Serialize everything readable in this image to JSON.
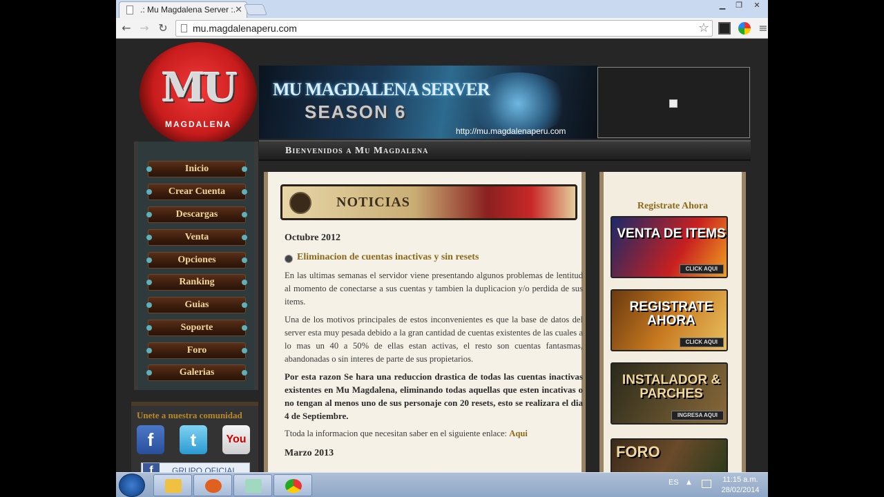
{
  "browser": {
    "tab_title": ".: Mu Magdalena Server :.",
    "url": "mu.magdalenaperu.com"
  },
  "header": {
    "logo_text": "MU",
    "logo_subtitle": "MAGDALENA",
    "banner_title": "MU MAGDALENA SERVER",
    "banner_season": "SEASON 6",
    "banner_url": "http://mu.magdalenaperu.com",
    "welcome": "Bienvenidos a Mu Magdalena"
  },
  "nav": {
    "items": [
      "Inicio",
      "Crear Cuenta",
      "Descargas",
      "Venta",
      "Opciones",
      "Ranking",
      "Guias",
      "Soporte",
      "Foro",
      "Galerias"
    ]
  },
  "community": {
    "title": "Unete a nuestra comunidad",
    "facebook": "f",
    "twitter": "t",
    "youtube": "You",
    "grupo": "GRUPO OFICIAL"
  },
  "news": {
    "section_title": "NOTICIAS",
    "month1": "Octubre 2012",
    "headline1": "Eliminacion de cuentas inactivas y sin resets",
    "p1": "En las ultimas semanas el servidor viene presentando algunos problemas de lentitud al momento de conectarse a sus cuentas y tambien la duplicacion y/o perdida de sus items.",
    "p2": "Una de los motivos principales de estos inconvenientes es que la base de datos del server esta muy pesada debido a la gran cantidad de cuentas existentes de las cuales a lo mas un 40 a 50% de ellas estan activas, el resto son cuentas fantasmas, abandonadas o sin interes de parte de sus propietarios.",
    "p3": "Por esta razon Se hara una reduccion drastica de todas las cuentas inactivas existentes en Mu Magdalena, eliminando todas aquellas que esten incativas o no tengan al menos uno de sus personaje con 20 resets, esto se realizara el dia 4 de Septiembre.",
    "p4": "Ttoda la informacion que necesitan saber en el siguiente enlace:",
    "p4_link": "Aqui",
    "month2": "Marzo 2013"
  },
  "sidebar_right": {
    "registrate_title": "Registrate Ahora",
    "promos": [
      {
        "title": "VENTA DE ITEMS",
        "button": "CLICK AQUI"
      },
      {
        "title": "REGISTRATE AHORA",
        "button": "CLICK AQUI"
      },
      {
        "title": "INSTALADOR & PARCHES",
        "button": "INGRESA AQUI"
      },
      {
        "title": "FORO",
        "button": ""
      }
    ]
  },
  "taskbar": {
    "language": "ES",
    "time": "11:15 a.m.",
    "date": "28/02/2014"
  },
  "colors": {
    "nav_text": "#f2d79a",
    "accent_gold": "#8a6a1a",
    "content_bg": "#f6f1e6"
  }
}
